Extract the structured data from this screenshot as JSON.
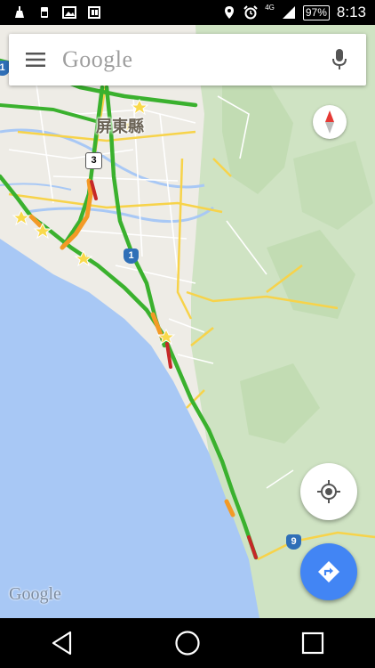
{
  "status_bar": {
    "time": "8:13",
    "battery": "97%",
    "network": "4G",
    "icons": [
      "cleaner-icon",
      "phone-clean-icon",
      "image-icon",
      "sim-icon",
      "location-icon",
      "alarm-icon",
      "signal-icon"
    ]
  },
  "search": {
    "placeholder": "Google"
  },
  "map": {
    "place_label": "屏東縣",
    "road_shields": [
      "1",
      "3",
      "9",
      "1"
    ],
    "watermark": "Google",
    "colors": {
      "sea": "#a8c8f5",
      "land": "#eeece6",
      "forest": "#cfe3c3",
      "traffic_green": "#3ab12e",
      "traffic_orange": "#f39a26",
      "traffic_red": "#c62828",
      "road_yellow": "#f7d34a"
    }
  },
  "controls": {
    "compass": "compass-icon",
    "locate": "my-location-icon",
    "directions": "directions-icon"
  },
  "nav_bar": {
    "buttons": [
      "back-icon",
      "home-icon",
      "recents-icon"
    ]
  }
}
